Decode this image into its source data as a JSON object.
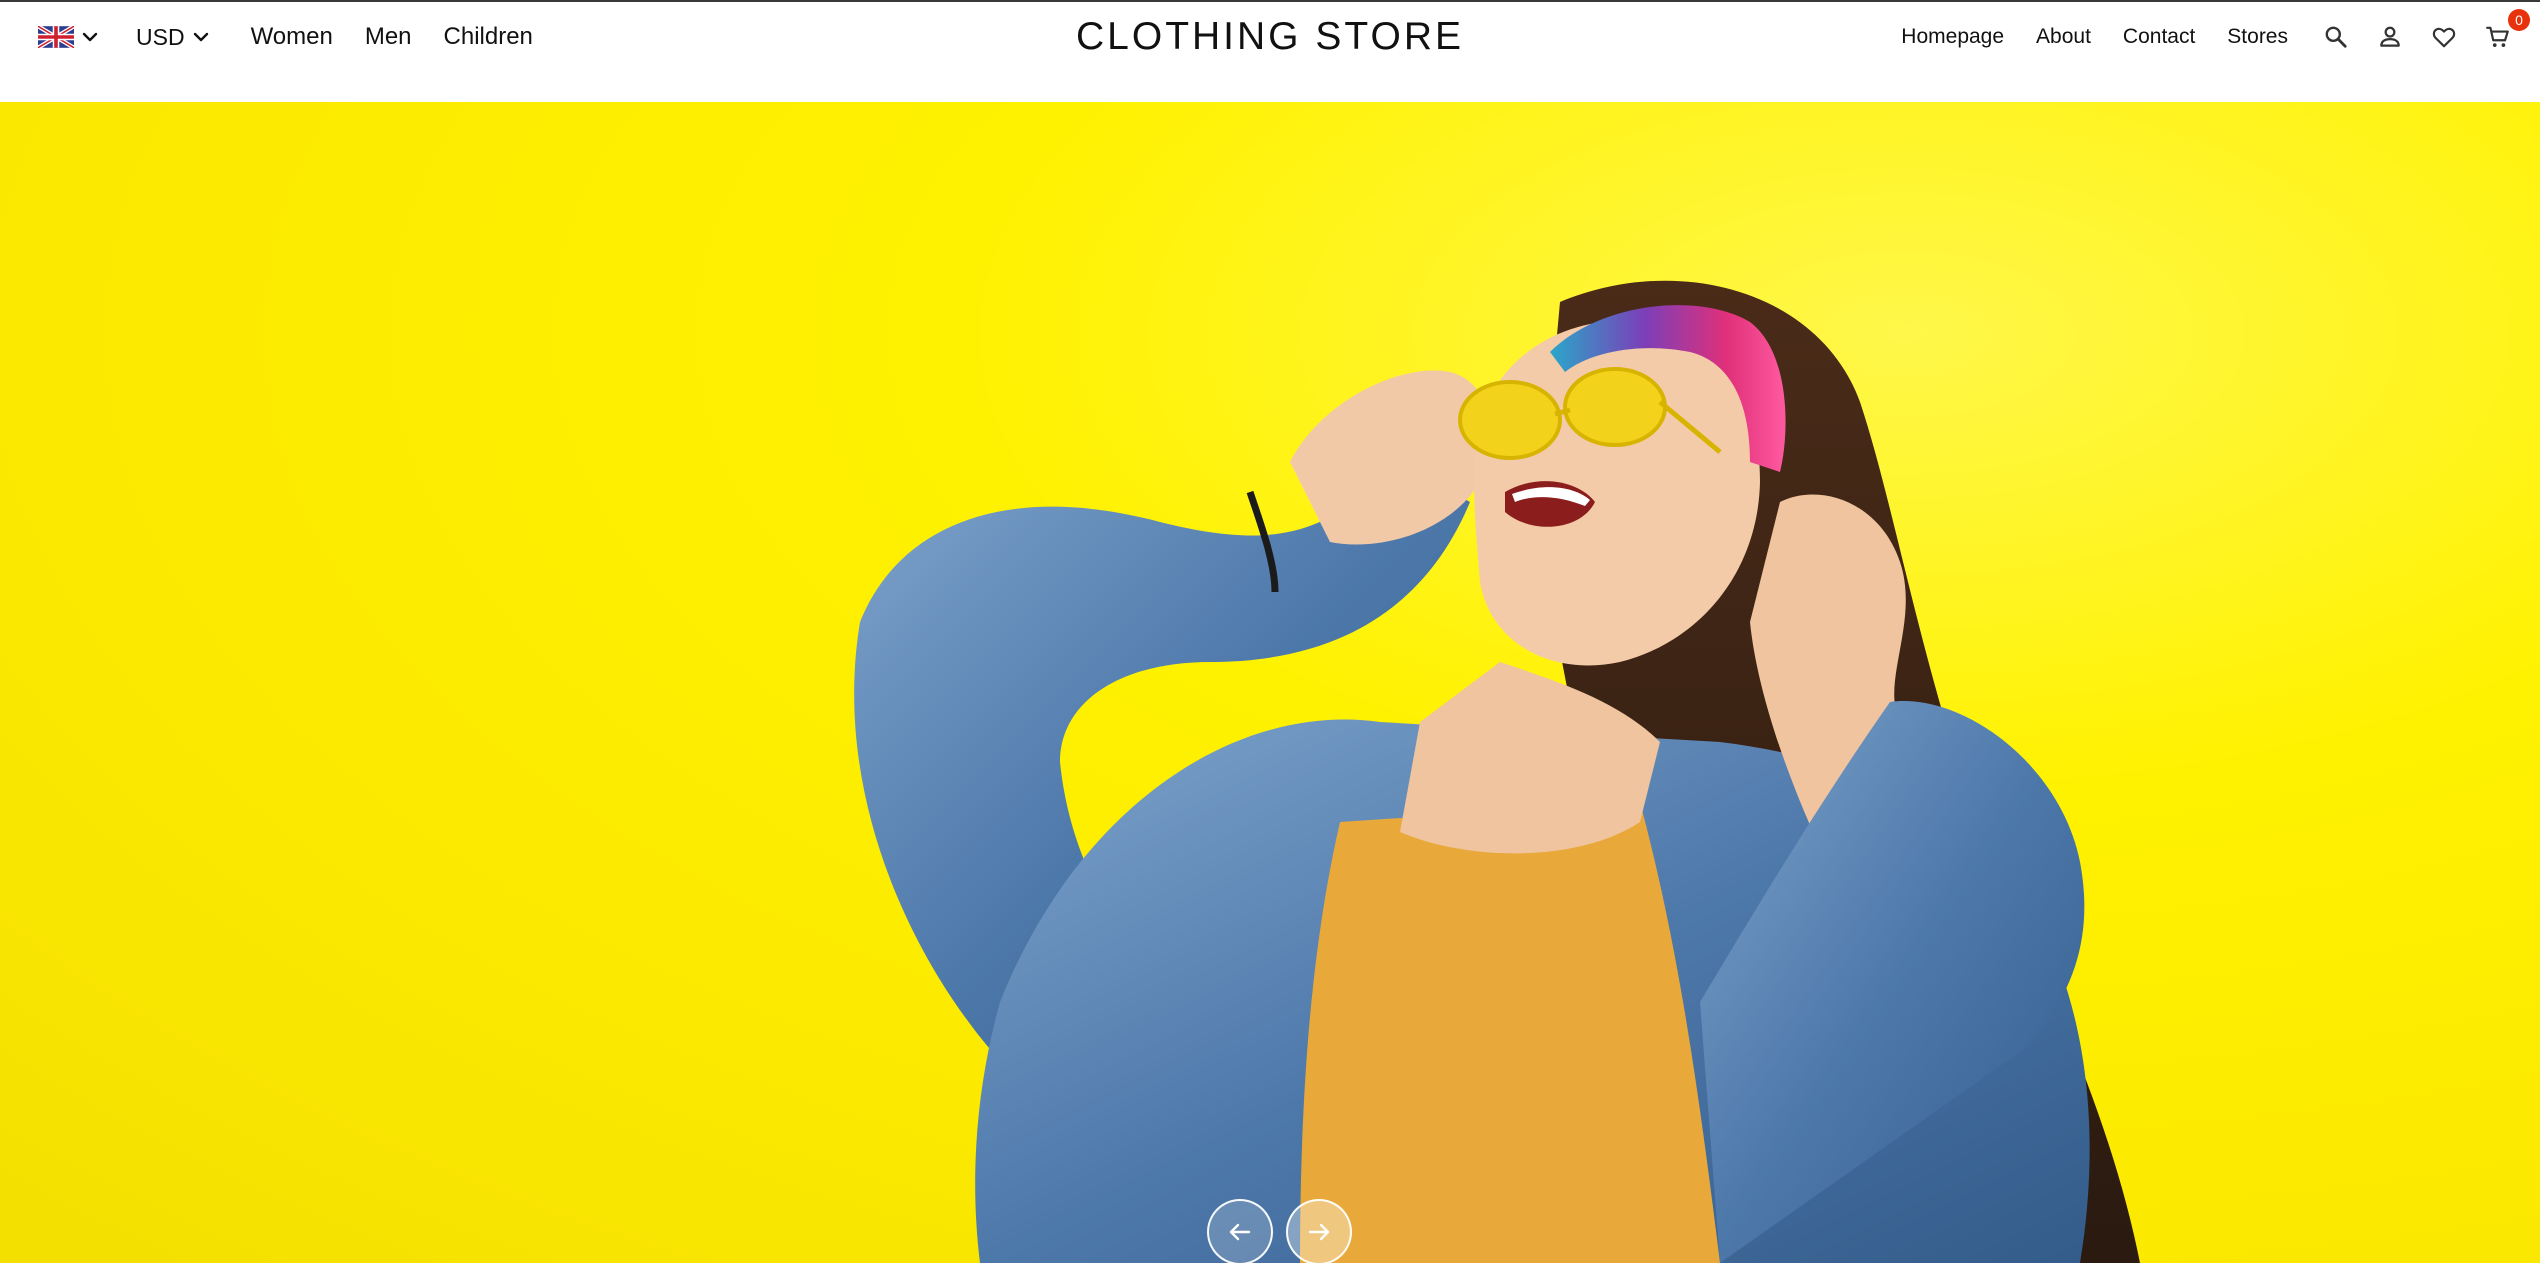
{
  "header": {
    "language": {
      "flag_icon": "uk-flag-icon",
      "dropdown_icon": "chevron-down-icon"
    },
    "currency": {
      "label": "USD",
      "dropdown_icon": "chevron-down-icon"
    },
    "categories": [
      "Women",
      "Men",
      "Children"
    ],
    "brand": "CLOTHING STORE",
    "pages": [
      "Homepage",
      "About",
      "Contact",
      "Stores"
    ],
    "icons": [
      "search-icon",
      "user-icon",
      "heart-icon",
      "cart-icon"
    ],
    "cart_count": "0",
    "badge_color": "#e8320c"
  },
  "hero": {
    "background_color": "#fff200",
    "image": "woman-in-denim-jacket-and-yellow-sunglasses",
    "controls": {
      "prev_icon": "arrow-left-icon",
      "next_icon": "arrow-right-icon"
    }
  }
}
